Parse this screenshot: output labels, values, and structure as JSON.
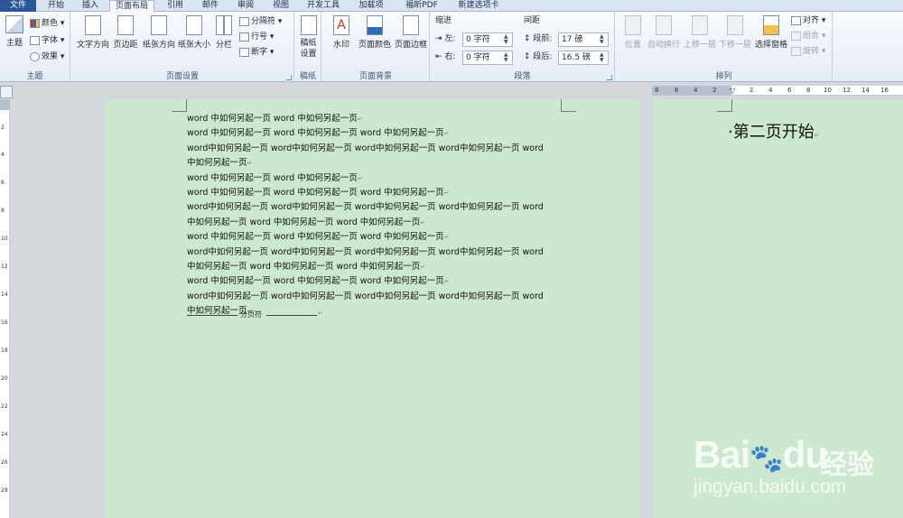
{
  "tabs": [
    {
      "label": "文件",
      "file": true
    },
    {
      "label": "开始"
    },
    {
      "label": "插入"
    },
    {
      "label": "页面布局",
      "active": true
    },
    {
      "label": "引用"
    },
    {
      "label": "邮件"
    },
    {
      "label": "审阅"
    },
    {
      "label": "视图"
    },
    {
      "label": "开发工具"
    },
    {
      "label": "加载项"
    },
    {
      "label": "福昕PDF"
    },
    {
      "label": "新建选项卡"
    }
  ],
  "groups": {
    "theme": {
      "label": "主题",
      "big": "主题",
      "colors": "颜色",
      "fonts": "字体",
      "effects": "效果"
    },
    "page_setup": {
      "label": "页面设置",
      "text_dir": "文字方向",
      "margins": "页边距",
      "orientation": "纸张方向",
      "size": "纸张大小",
      "columns": "分栏",
      "breaks": "分隔符",
      "line_numbers": "行号",
      "hyphenation": "断字"
    },
    "draft": {
      "label": "稿纸",
      "btn": "稿纸设置"
    },
    "background": {
      "label": "页面背景",
      "watermark": "水印",
      "page_color": "页面颜色",
      "page_borders": "页面边框"
    },
    "paragraph": {
      "label": "段落",
      "indent_title": "缩进",
      "spacing_title": "间距",
      "left_label": "左:",
      "right_label": "右:",
      "before_label": "段前:",
      "after_label": "段后:",
      "indent_left": "0 字符",
      "indent_right": "0 字符",
      "space_before": "17 磅",
      "space_after": "16.5 磅"
    },
    "arrange": {
      "label": "排列",
      "position": "位置",
      "wrap": "自动换行",
      "forward": "上移一层",
      "backward": "下移一层",
      "selection_pane": "选择窗格",
      "align": "对齐",
      "group": "组合",
      "rotate": "旋转"
    }
  },
  "ruler": {
    "top_numbers": [
      "8",
      "6",
      "4",
      "2",
      "",
      "2",
      "4",
      "6",
      "8",
      "10",
      "12",
      "14",
      "16"
    ],
    "left_numbers": [
      "2",
      "4",
      "6",
      "8",
      "10",
      "12",
      "14",
      "16",
      "18",
      "20",
      "22",
      "24",
      "26",
      "28"
    ]
  },
  "document": {
    "page1_lines": [
      "word 中如何另起一页 word 中如何另起一页",
      "word 中如何另起一页 word 中如何另起一页 word 中如何另起一页",
      "word中如何另起一页 word中如何另起一页 word中如何另起一页 word中如何另起一页 word",
      "中如何另起一页",
      "word 中如何另起一页 word 中如何另起一页",
      "word 中如何另起一页 word 中如何另起一页 word 中如何另起一页",
      "word中如何另起一页 word中如何另起一页 word中如何另起一页 word中如何另起一页 word",
      "中如何另起一页 word 中如何另起一页 word 中如何另起一页",
      "word 中如何另起一页 word 中如何另起一页 word 中如何另起一页",
      "word中如何另起一页 word中如何另起一页 word中如何另起一页 word中如何另起一页 word",
      "中如何另起一页 word 中如何另起一页 word 中如何另起一页",
      "word 中如何另起一页 word 中如何另起一页 word 中如何另起一页",
      "word中如何另起一页 word中如何另起一页 word中如何另起一页 word中如何另起一页 word",
      "中如何另起一页"
    ],
    "paragraph_marks": [
      "↵",
      "↵",
      "",
      "↵",
      "↵",
      "↵",
      "",
      "↵",
      "↵",
      "",
      "↵",
      "↵",
      "",
      "↵"
    ],
    "page_break_label": "分页符",
    "page_break_mark": "↵",
    "page2_text": "·第二页开始",
    "page2_mark": "↵"
  },
  "watermark": {
    "brand": "Bai",
    "brand_suffix": "du",
    "jingyan": "经验",
    "url": "jingyan.baidu.com"
  },
  "colors": {
    "page_bg": "#cce8cf",
    "file_tab": "#2b579a"
  }
}
